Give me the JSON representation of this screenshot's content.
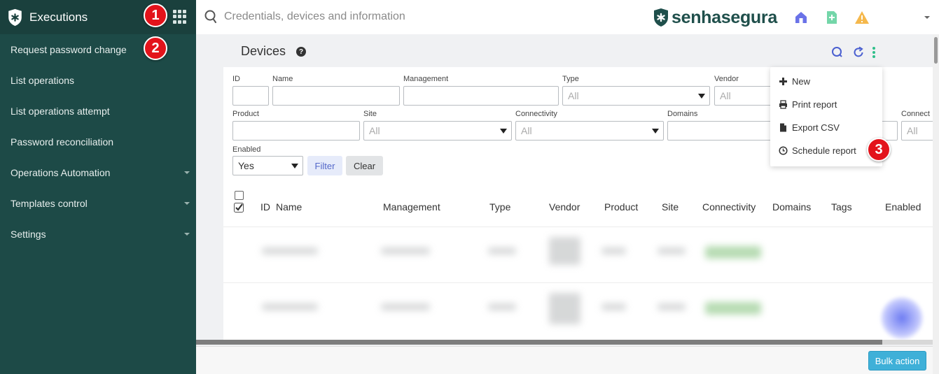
{
  "sidebar": {
    "title": "Executions",
    "items": [
      {
        "label": "Request password change",
        "has_submenu": false
      },
      {
        "label": "List operations",
        "has_submenu": false
      },
      {
        "label": "List operations attempt",
        "has_submenu": false
      },
      {
        "label": "Password reconciliation",
        "has_submenu": false
      },
      {
        "label": "Operations Automation",
        "has_submenu": true
      },
      {
        "label": "Templates control",
        "has_submenu": true
      },
      {
        "label": "Settings",
        "has_submenu": true
      }
    ]
  },
  "topbar": {
    "search_placeholder": "Credentials, devices and information",
    "brand": "senhasegura",
    "icons": [
      "home-icon",
      "new-request-icon",
      "warning-icon",
      "user-menu-caret"
    ]
  },
  "badges": [
    "1",
    "2",
    "3"
  ],
  "page": {
    "title": "Devices",
    "help": "?"
  },
  "filters": {
    "row1": [
      {
        "label": "ID",
        "type": "input",
        "value": ""
      },
      {
        "label": "Name",
        "type": "input",
        "value": ""
      },
      {
        "label": "Management",
        "type": "input",
        "value": ""
      },
      {
        "label": "Type",
        "type": "select",
        "value": "All"
      },
      {
        "label": "Vendor",
        "type": "select",
        "value": "All"
      }
    ],
    "row2": [
      {
        "label": "Product",
        "type": "input",
        "value": ""
      },
      {
        "label": "Site",
        "type": "select",
        "value": "All"
      },
      {
        "label": "Connectivity",
        "type": "select",
        "value": "All"
      },
      {
        "label": "Domains",
        "type": "input",
        "value": ""
      },
      {
        "label": "Connect",
        "type": "select",
        "value": "All"
      }
    ],
    "enabled": {
      "label": "Enabled",
      "value": "Yes"
    },
    "filter_button": "Filter",
    "clear_button": "Clear"
  },
  "table": {
    "columns": [
      "ID",
      "Name",
      "Management",
      "Type",
      "Vendor",
      "Product",
      "Site",
      "Connectivity",
      "Domains",
      "Tags",
      "Enabled"
    ]
  },
  "menu": {
    "items": [
      {
        "label": "New",
        "icon": "plus-icon"
      },
      {
        "label": "Print report",
        "icon": "printer-icon"
      },
      {
        "label": "Export CSV",
        "icon": "file-icon"
      },
      {
        "label": "Schedule report",
        "icon": "clock-icon"
      }
    ]
  },
  "footer": {
    "bulk_action": "Bulk action"
  },
  "colors": {
    "sidebar_bg": "#1d4a47",
    "brand": "#1f4f4b",
    "badge": "#e3131b",
    "accent_blue": "#3fb0d8",
    "filter_btn": "#5468c9",
    "kebab_green": "#2fbf8a"
  }
}
